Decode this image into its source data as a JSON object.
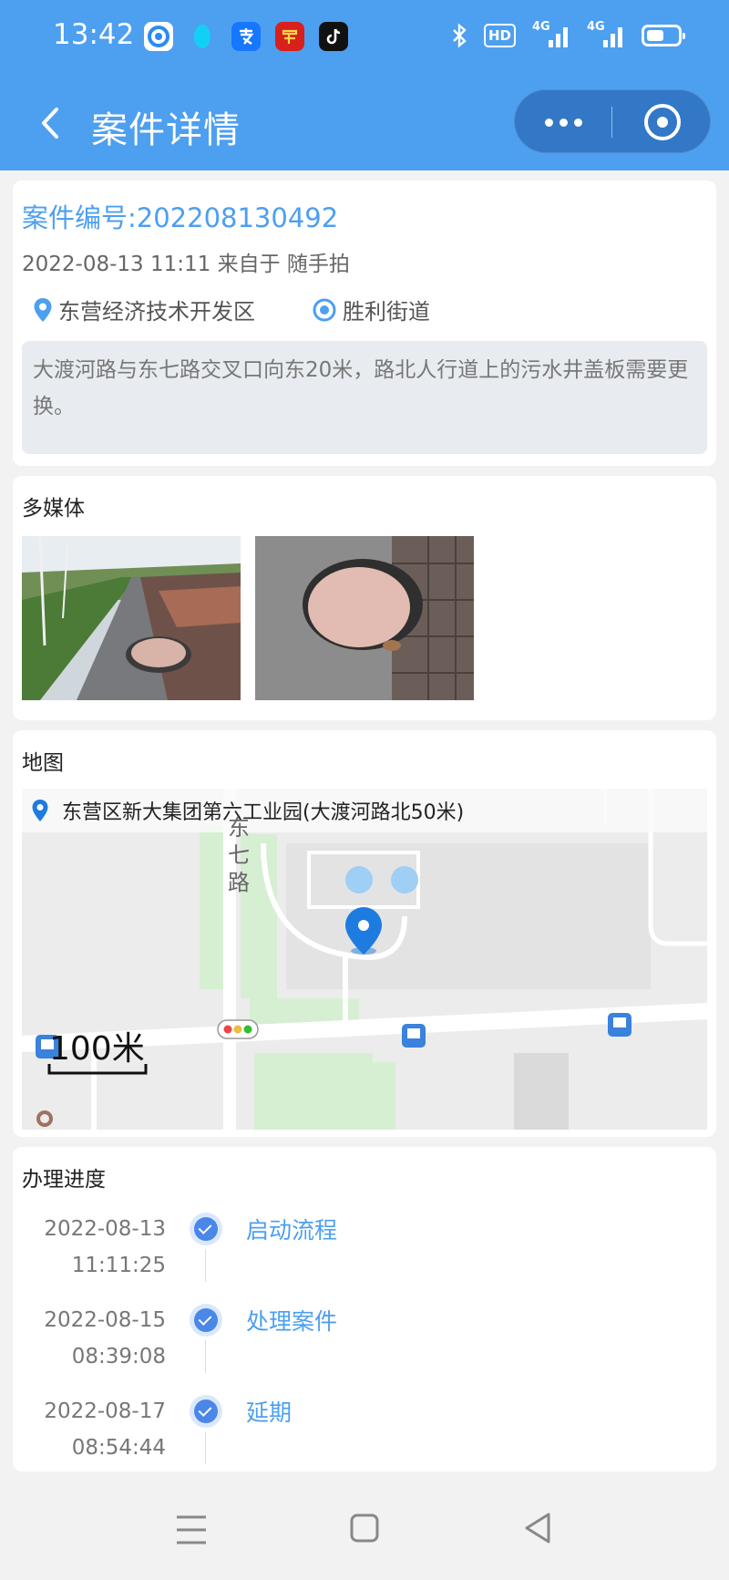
{
  "status_bar": {
    "time": "13:42",
    "hd_label": "HD",
    "signal1_label": "4G",
    "signal2_label": "4G",
    "app_icons": [
      "location-app-icon",
      "qq-icon",
      "alipay-icon",
      "xuexi-icon",
      "douyin-icon"
    ]
  },
  "navbar": {
    "title": "案件详情"
  },
  "case": {
    "number_label": "案件编号:202208130492",
    "meta": "2022-08-13 11:11 来自于 随手拍",
    "district": "东营经济技术开发区",
    "street": "胜利街道",
    "description": "大渡河路与东七路交叉口向东20米，路北人行道上的污水井盖板需要更换。"
  },
  "media": {
    "title": "多媒体"
  },
  "map": {
    "title": "地图",
    "address": "东营区新大集团第六工业园(大渡河路北50米)",
    "road_label": "东七路",
    "scale_label": "100米"
  },
  "progress": {
    "title": "办理进度",
    "items": [
      {
        "date": "2022-08-13",
        "time": "11:11:25",
        "label": "启动流程"
      },
      {
        "date": "2022-08-15",
        "time": "08:39:08",
        "label": "处理案件"
      },
      {
        "date": "2022-08-17",
        "time": "08:54:44",
        "label": "延期"
      }
    ]
  },
  "colors": {
    "accent": "#4d9ff0",
    "header_bg": "#4d9ff0",
    "timeline_dot": "#4a87e8"
  }
}
